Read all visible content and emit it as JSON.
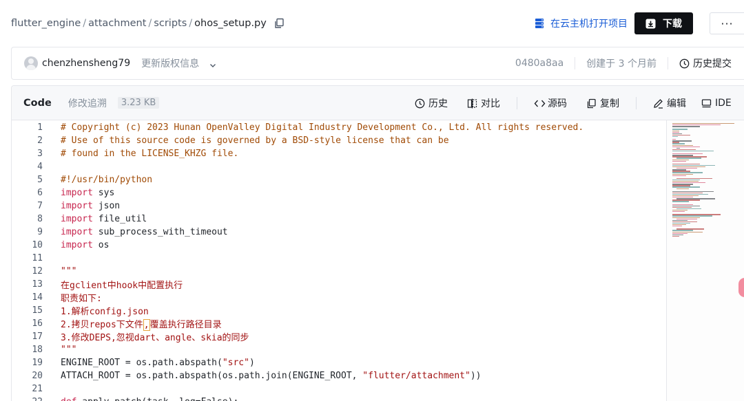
{
  "breadcrumb": {
    "parts": [
      "flutter_engine",
      "attachment",
      "scripts"
    ],
    "separator": "/",
    "file": "ohos_setup.py"
  },
  "header": {
    "open_cloud_label": "在云主机打开项目",
    "download_label": "下载",
    "more_label": "···",
    "accent_color": "#1a5dd6"
  },
  "commit": {
    "author": "chenzhensheng79",
    "message": "更新版权信息",
    "sha": "0480a8aa",
    "created": "创建于 3 个月前",
    "history_label": "历史提交"
  },
  "file": {
    "tab_code": "Code",
    "tab_blame": "修改追溯",
    "size": "3.23 KB",
    "actions": {
      "history": "历史",
      "compare": "对比",
      "source": "源码",
      "copy": "复制",
      "edit": "编辑",
      "ide": "IDE"
    }
  },
  "code_lines": [
    {
      "n": "1",
      "segs": [
        [
          "comment",
          "# Copyright (c) 2023 Hunan OpenValley Digital Industry Development Co., Ltd. All rights reserved."
        ]
      ]
    },
    {
      "n": "2",
      "segs": [
        [
          "comment",
          "# Use of this source code is governed by a BSD-style license that can be"
        ]
      ]
    },
    {
      "n": "3",
      "segs": [
        [
          "comment",
          "# found in the LICENSE_KHZG file."
        ]
      ]
    },
    {
      "n": "4",
      "segs": []
    },
    {
      "n": "5",
      "segs": [
        [
          "comment",
          "#!/usr/bin/python"
        ]
      ]
    },
    {
      "n": "6",
      "segs": [
        [
          "kw",
          "import"
        ],
        [
          "plain",
          " sys"
        ]
      ]
    },
    {
      "n": "7",
      "segs": [
        [
          "kw",
          "import"
        ],
        [
          "plain",
          " json"
        ]
      ]
    },
    {
      "n": "8",
      "segs": [
        [
          "kw",
          "import"
        ],
        [
          "plain",
          " file_util"
        ]
      ]
    },
    {
      "n": "9",
      "segs": [
        [
          "kw",
          "import"
        ],
        [
          "plain",
          " sub_process_with_timeout"
        ]
      ]
    },
    {
      "n": "10",
      "segs": [
        [
          "kw",
          "import"
        ],
        [
          "plain",
          " os"
        ]
      ]
    },
    {
      "n": "11",
      "segs": []
    },
    {
      "n": "12",
      "segs": [
        [
          "str",
          "\"\"\""
        ]
      ]
    },
    {
      "n": "13",
      "segs": [
        [
          "str",
          "在gclient中hook中配置执行"
        ]
      ]
    },
    {
      "n": "14",
      "segs": [
        [
          "str",
          "职责如下:"
        ]
      ]
    },
    {
      "n": "15",
      "segs": [
        [
          "str",
          "1.解析config.json"
        ]
      ]
    },
    {
      "n": "16",
      "segs": [
        [
          "str",
          "2.拷贝repos下文件"
        ],
        [
          "cursor",
          ","
        ],
        [
          "str",
          "覆盖执行路径目录"
        ]
      ]
    },
    {
      "n": "17",
      "segs": [
        [
          "str",
          "3.修改DEPS,忽视dart、angle、skia的同步"
        ]
      ]
    },
    {
      "n": "18",
      "segs": [
        [
          "str",
          "\"\"\""
        ]
      ]
    },
    {
      "n": "19",
      "segs": [
        [
          "plain",
          "ENGINE_ROOT = os.path.abspath("
        ],
        [
          "str",
          "\"src\""
        ],
        [
          "plain",
          ")"
        ]
      ]
    },
    {
      "n": "20",
      "segs": [
        [
          "plain",
          "ATTACH_ROOT = os.path.abspath(os.path.join(ENGINE_ROOT, "
        ],
        [
          "str",
          "\"flutter/attachment\""
        ],
        [
          "plain",
          "))"
        ]
      ]
    },
    {
      "n": "21",
      "segs": []
    },
    {
      "n": "22",
      "segs": [
        [
          "kw",
          "def"
        ],
        [
          "plain",
          " apply_patch(task, log=False):"
        ]
      ]
    }
  ]
}
